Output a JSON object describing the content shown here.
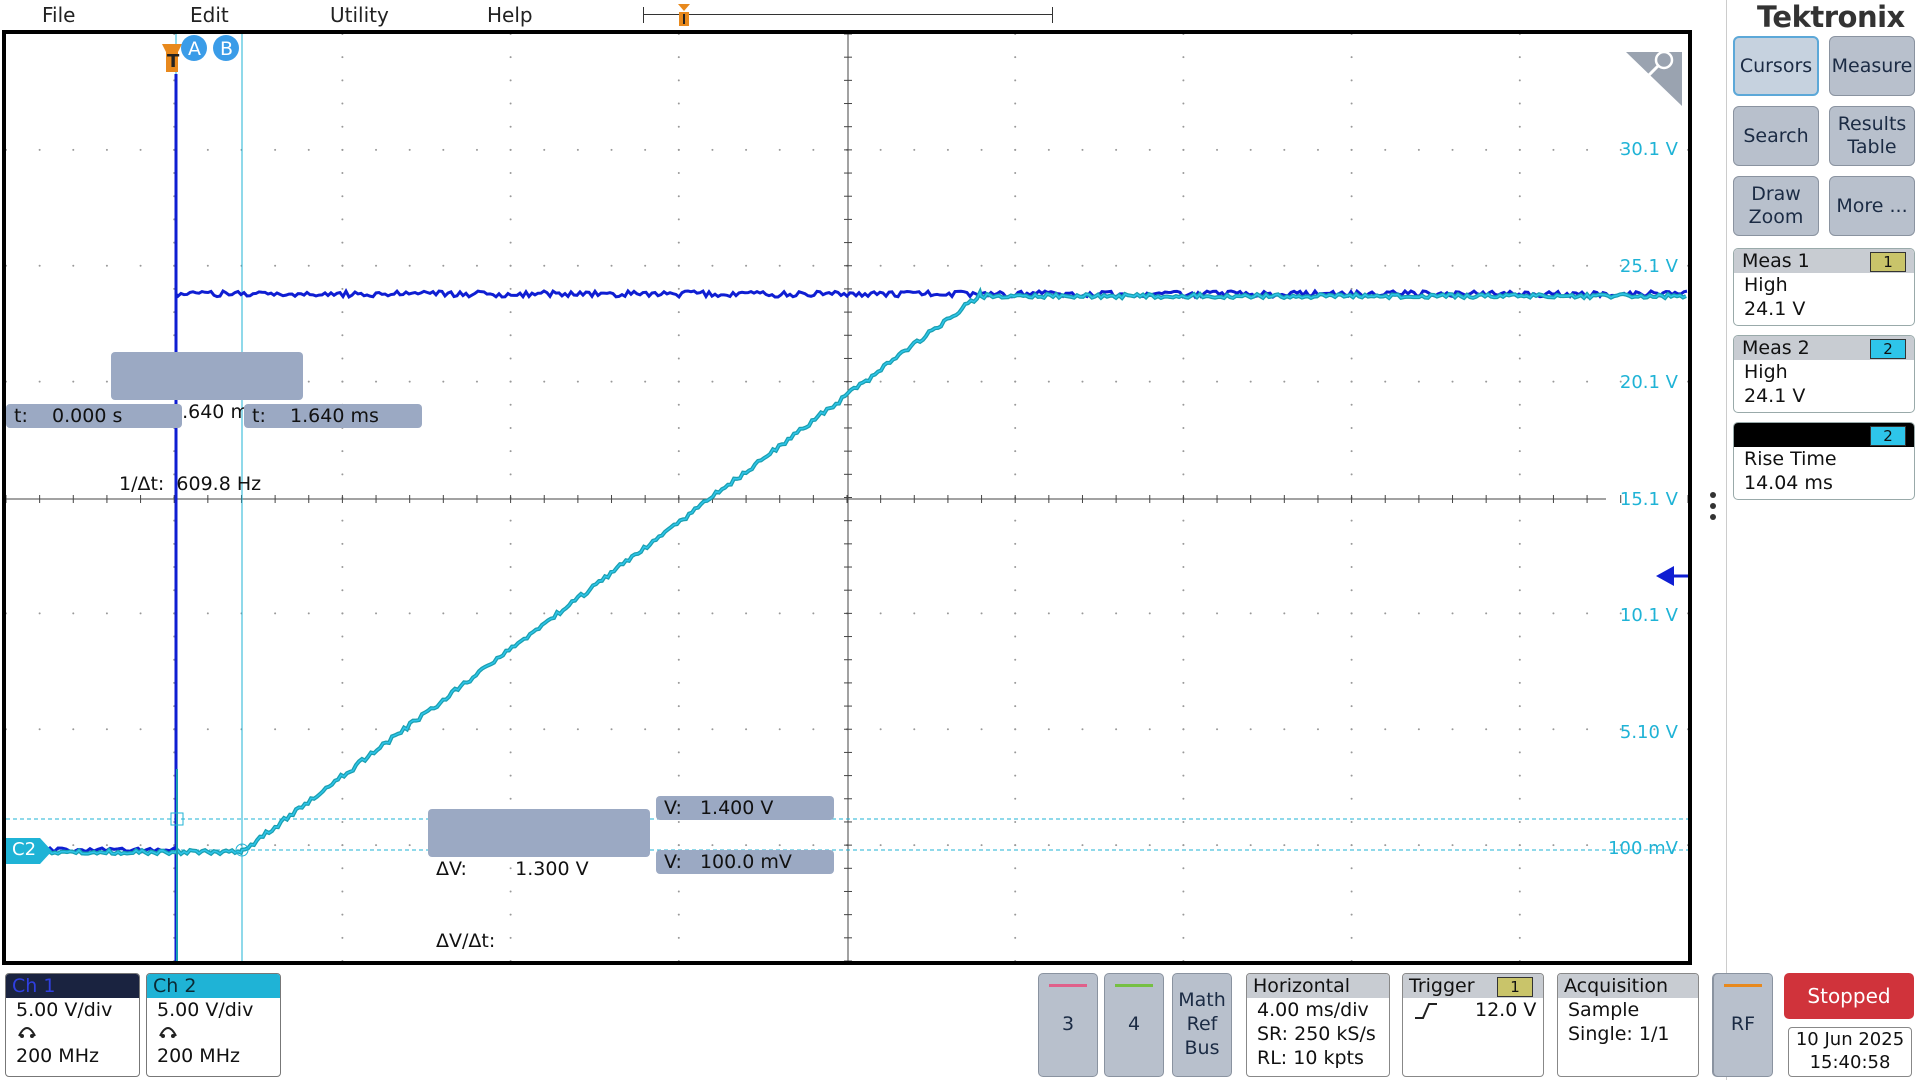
{
  "menu": {
    "items": [
      "File",
      "Edit",
      "Utility",
      "Help"
    ]
  },
  "brand": "Tektronix",
  "side_panel": {
    "buttons": [
      {
        "label_lines": [
          "Cursors"
        ],
        "active": true
      },
      {
        "label_lines": [
          "Measure"
        ],
        "active": false
      },
      {
        "label_lines": [
          "Search"
        ],
        "active": false
      },
      {
        "label_lines": [
          "Results",
          "Table"
        ],
        "active": false
      },
      {
        "label_lines": [
          "Draw",
          "Zoom"
        ],
        "active": false
      },
      {
        "label_lines": [
          "More ..."
        ],
        "active": false
      }
    ],
    "meas1": {
      "title": "Meas 1",
      "badge": "1",
      "name": "High",
      "value": "24.1 V"
    },
    "meas2": {
      "title": "Meas 2",
      "badge": "2",
      "name": "High",
      "value": "24.1 V"
    },
    "meas3": {
      "title": "",
      "badge": "2",
      "name": "Rise Time",
      "value": "14.04 ms"
    }
  },
  "colors": {
    "ch1": "#0f1ed2",
    "ch2": "#1fb3d6",
    "readout_bg": "#9ba9c3",
    "meas1_badge": "#c9c46a",
    "meas2_badge": "#2ec5ea",
    "stopped": "#d0333b"
  },
  "volt_labels": [
    "30.1 V",
    "25.1 V",
    "20.1 V",
    "15.1 V",
    "10.1 V",
    "5.10 V",
    "100 mV"
  ],
  "cursors": {
    "a_label": "A",
    "b_label": "B",
    "delta_t": "Δt:    1.640 ms",
    "inv_delta_t": "1/Δt:  609.8 Hz",
    "t_a": "t:    0.000 s",
    "t_b": "t:    1.640 ms",
    "delta_v": "ΔV:        1.300 V",
    "delta_v_dt": "ΔV/Δt:",
    "v_a": "V:   1.400 V",
    "v_b": "V:   100.0 mV"
  },
  "channel_marker_c2": "C2",
  "trigger_marker": "T",
  "bottom": {
    "ch1": {
      "title": "Ch 1",
      "scale": "5.00 V/div",
      "bandwidth": "200 MHz"
    },
    "ch2": {
      "title": "Ch 2",
      "scale": "5.00 V/div",
      "bandwidth": "200 MHz"
    },
    "btn3": "3",
    "btn4": "4",
    "math_lines": [
      "Math",
      "Ref",
      "Bus"
    ],
    "horizontal": {
      "title": "Horizontal",
      "scale": "4.00 ms/div",
      "sr": "SR: 250 kS/s",
      "rl": "RL: 10 kpts"
    },
    "trigger": {
      "title": "Trigger",
      "badge": "1",
      "level": "12.0 V"
    },
    "acquisition": {
      "title": "Acquisition",
      "mode": "Sample",
      "single": "Single: 1/1"
    },
    "rf": "RF",
    "status": "Stopped",
    "date": "10 Jun 2025",
    "time": "15:40:58"
  }
}
